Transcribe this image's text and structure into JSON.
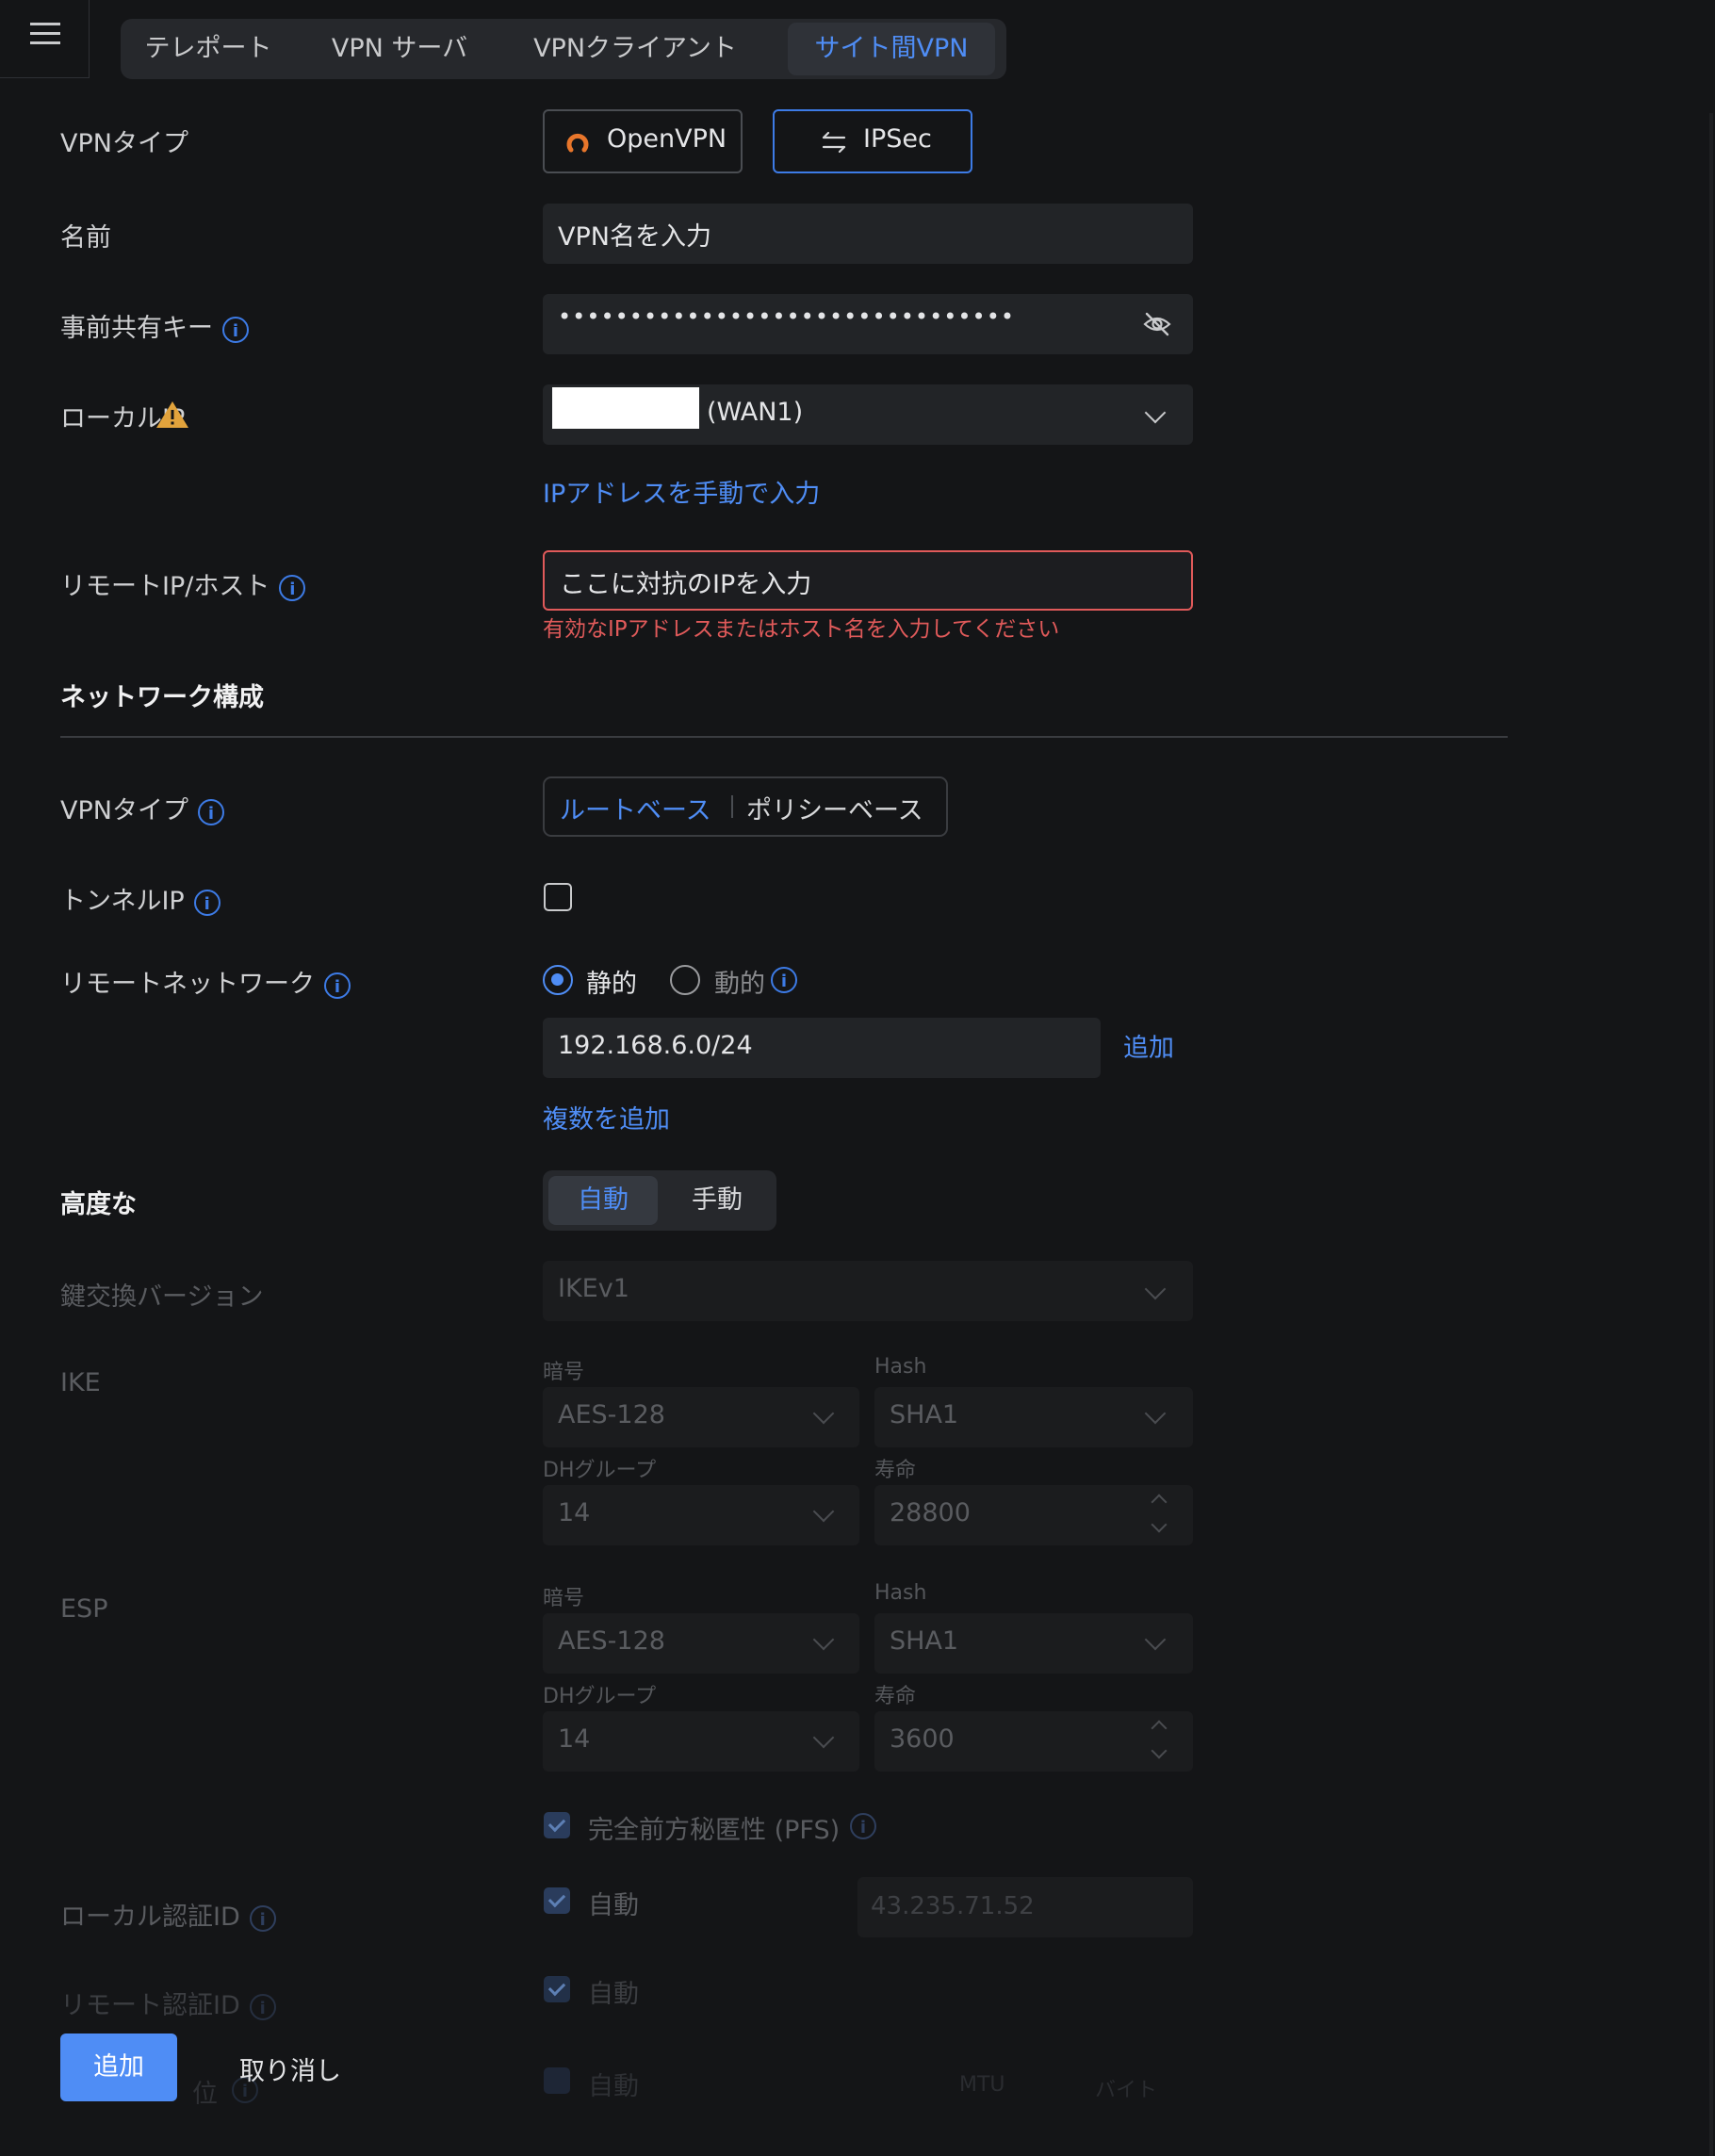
{
  "tabs": [
    "テレポート",
    "VPN サーバ",
    "VPNクライアント",
    "サイト間VPN"
  ],
  "active_tab": "サイト間VPN",
  "form": {
    "vpn_type_label": "VPNタイプ",
    "vpn_type_options": [
      "OpenVPN",
      "IPSec"
    ],
    "name_label": "名前",
    "name_value": "VPN名を入力",
    "psk_label": "事前共有キー",
    "psk_value": "••••••••••••••••••••••••••••••••",
    "local_ip_label": "ローカルIP",
    "local_ip_suffix": "(WAN1)",
    "manual_ip_link": "IPアドレスを手動で入力",
    "remote_label": "リモートIP/ホスト",
    "remote_value": "ここに対抗のIPを入力",
    "remote_error": "有効なIPアドレスまたはホスト名を入力してください"
  },
  "network": {
    "heading": "ネットワーク構成",
    "vpn_type_label": "VPNタイプ",
    "route_based": "ルートベース",
    "policy_based": "ポリシーベース",
    "tunnel_ip_label": "トンネルIP",
    "remote_network_label": "リモートネットワーク",
    "static_label": "静的",
    "dynamic_label": "動的",
    "subnet_value": "192.168.6.0/24",
    "add_link": "追加",
    "add_multiple_link": "複数を追加"
  },
  "advanced": {
    "heading": "高度な",
    "auto": "自動",
    "manual": "手動",
    "key_exchange_label": "鍵交換バージョン",
    "key_exchange_value": "IKEv1",
    "ike_label": "IKE",
    "esp_label": "ESP",
    "cipher_label": "暗号",
    "hash_label": "Hash",
    "dh_label": "DHグループ",
    "life_label": "寿命",
    "ike_cipher": "AES-128",
    "ike_hash": "SHA1",
    "ike_dh": "14",
    "ike_life": "28800",
    "esp_cipher": "AES-128",
    "esp_hash": "SHA1",
    "esp_dh": "14",
    "esp_life": "3600",
    "pfs_label": "完全前方秘匿性 (PFS)",
    "local_auth_label": "ローカル認証ID",
    "local_auth_auto": "自動",
    "local_auth_value": "43.235.71.52",
    "remote_auth_label": "リモート認証ID",
    "remote_auth_auto": "自動",
    "mtu_label_partial": "位",
    "mtu_auto": "自動",
    "mtu_unit_a": "MTU",
    "mtu_unit_b": "バイト"
  },
  "footer": {
    "add_button": "追加",
    "cancel_button": "取り消し"
  }
}
